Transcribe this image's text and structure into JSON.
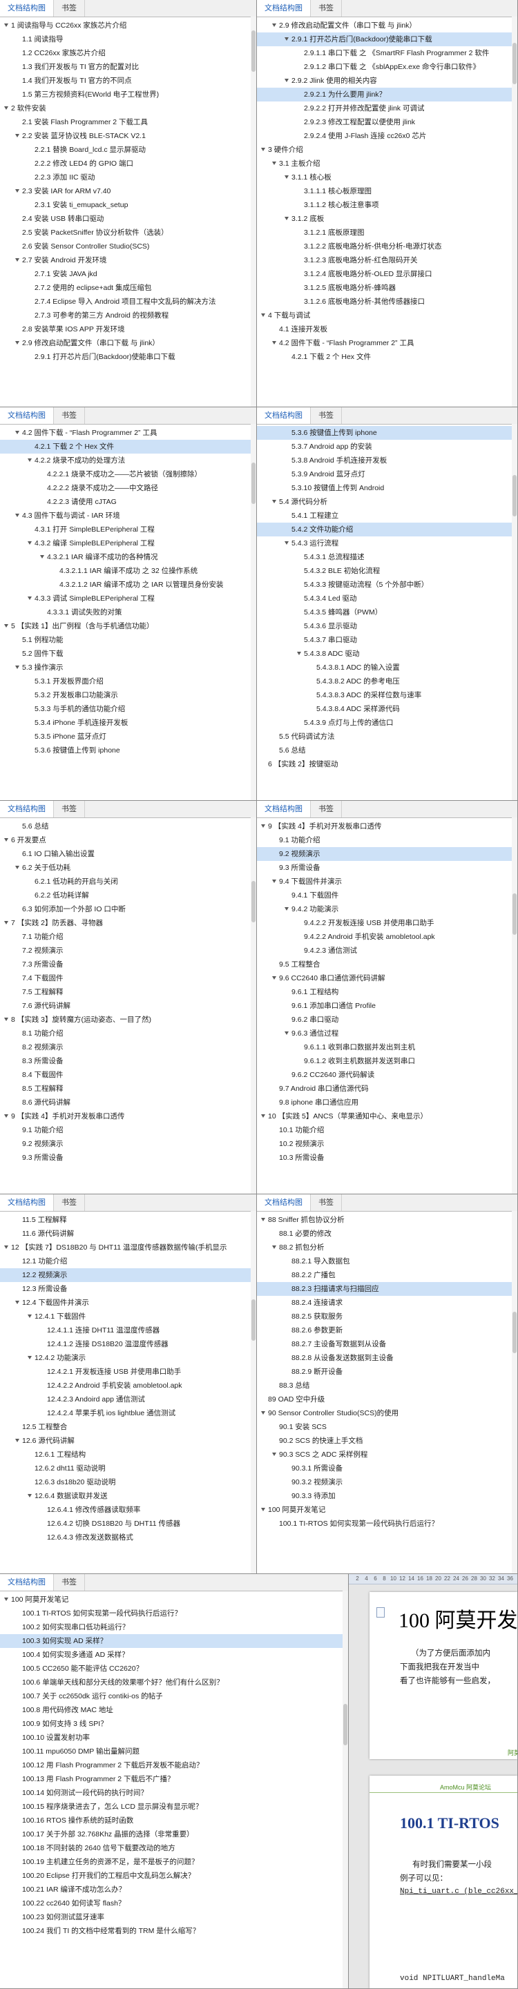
{
  "tabs": {
    "toc": "文档结构图",
    "bookmarks": "书签"
  },
  "panes": [
    {
      "id": "p1",
      "active_tab": "toc",
      "rows": [
        {
          "t": "1 阅读指导与 CC26xx 家族芯片介绍",
          "l": 0,
          "e": true
        },
        {
          "t": "1.1 阅读指导",
          "l": 1
        },
        {
          "t": "1.2 CC26xx 家族芯片介绍",
          "l": 1
        },
        {
          "t": "1.3 我们开发板与 TI 官方的配置对比",
          "l": 1
        },
        {
          "t": "1.4 我们开发板与 TI 官方的不同点",
          "l": 1
        },
        {
          "t": "1.5 第三方视频资料(EWorld 电子工程世界)",
          "l": 1
        },
        {
          "t": "2 软件安装",
          "l": 0,
          "e": true
        },
        {
          "t": "2.1 安装 Flash Programmer 2 下载工具",
          "l": 1
        },
        {
          "t": "2.2 安装 蓝牙协议栈 BLE-STACK V2.1",
          "l": 1,
          "e": true
        },
        {
          "t": "2.2.1 替换 Board_lcd.c 显示屏驱动",
          "l": 2
        },
        {
          "t": "2.2.2 修改 LED4 的 GPIO 端口",
          "l": 2
        },
        {
          "t": "2.2.3 添加 IIC 驱动",
          "l": 2
        },
        {
          "t": "2.3 安装 IAR for ARM v7.40",
          "l": 1,
          "e": true
        },
        {
          "t": "2.3.1 安装 ti_emupack_setup",
          "l": 2
        },
        {
          "t": "2.4 安装 USB 转串口驱动",
          "l": 1
        },
        {
          "t": "2.5 安装 PacketSniffer 协议分析软件（选装）",
          "l": 1
        },
        {
          "t": "2.6 安装 Sensor Controller Studio(SCS)",
          "l": 1
        },
        {
          "t": "2.7 安装 Android 开发环境",
          "l": 1,
          "e": true
        },
        {
          "t": "2.7.1 安装 JAVA jkd",
          "l": 2
        },
        {
          "t": "2.7.2 使用的 eclipse+adt 集成压缩包",
          "l": 2
        },
        {
          "t": "2.7.4 Eclipse 导入 Android 项目工程中文乱码的解决方法",
          "l": 2
        },
        {
          "t": "2.7.3 可参考的第三方 Android 的视频教程",
          "l": 2
        },
        {
          "t": "2.8 安装苹果 IOS APP 开发环境",
          "l": 1
        },
        {
          "t": "2.9 修改启动配置文件（串口下载 与 jlink）",
          "l": 1,
          "e": true
        },
        {
          "t": "2.9.1 打开芯片后门(Backdoor)使能串口下载",
          "l": 2
        }
      ]
    },
    {
      "id": "p2",
      "active_tab": "toc",
      "rows": [
        {
          "t": "2.9 修改启动配置文件（串口下载 与 jlink）",
          "l": 1,
          "e": true
        },
        {
          "t": "2.9.1 打开芯片后门(Backdoor)使能串口下载",
          "l": 2,
          "e": true,
          "sel": true
        },
        {
          "t": "2.9.1.1 串口下载 之 《SmartRF Flash Programmer 2 软件",
          "l": 3
        },
        {
          "t": "2.9.1.2 串口下载 之 《sblAppEx.exe 命令行串口软件》",
          "l": 3
        },
        {
          "t": "2.9.2 Jlink 使用的相关内容",
          "l": 2,
          "e": true
        },
        {
          "t": "2.9.2.1 为什么要用 jlink？",
          "l": 3,
          "sel": true
        },
        {
          "t": "2.9.2.2 打开并修改配置使 jlink 可调试",
          "l": 3
        },
        {
          "t": "2.9.2.3 修改工程配置以便使用 jlink",
          "l": 3
        },
        {
          "t": "2.9.2.4 使用 J-Flash 连接 cc26x0 芯片",
          "l": 3
        },
        {
          "t": "3 硬件介绍",
          "l": 0,
          "e": true
        },
        {
          "t": "3.1 主板介绍",
          "l": 1,
          "e": true
        },
        {
          "t": "3.1.1 核心板",
          "l": 2,
          "e": true
        },
        {
          "t": "3.1.1.1 核心板原理图",
          "l": 3
        },
        {
          "t": "3.1.1.2 核心板注意事项",
          "l": 3
        },
        {
          "t": "3.1.2 底板",
          "l": 2,
          "e": true
        },
        {
          "t": "3.1.2.1 底板原理图",
          "l": 3
        },
        {
          "t": "3.1.2.2 底板电路分析-供电分析-电源灯状态",
          "l": 3
        },
        {
          "t": "3.1.2.3 底板电路分析-红色限码开关",
          "l": 3
        },
        {
          "t": "3.1.2.4 底板电路分析-OLED 显示屏接口",
          "l": 3
        },
        {
          "t": "3.1.2.5 底板电路分析-蜂鸣器",
          "l": 3
        },
        {
          "t": "3.1.2.6 底板电路分析-其他传感器接口",
          "l": 3
        },
        {
          "t": "4 下载与调试",
          "l": 0,
          "e": true
        },
        {
          "t": "4.1 连接开发板",
          "l": 1
        },
        {
          "t": "4.2 固件下载 - “Flash Programmer 2” 工具",
          "l": 1,
          "e": true
        },
        {
          "t": "4.2.1 下载 2 个 Hex 文件",
          "l": 2
        }
      ]
    },
    {
      "id": "p3",
      "active_tab": "toc",
      "rows": [
        {
          "t": "4.2 固件下载 - “Flash Programmer 2” 工具",
          "l": 1,
          "e": true
        },
        {
          "t": "4.2.1 下载 2 个 Hex 文件",
          "l": 2,
          "sel": true
        },
        {
          "t": "4.2.2 烧录不成功的处理方法",
          "l": 2,
          "e": true
        },
        {
          "t": "4.2.2.1 烧录不成功之——芯片被锁（强制擦除）",
          "l": 3
        },
        {
          "t": "4.2.2.2 烧录不成功之——中文路径",
          "l": 3
        },
        {
          "t": "4.2.2.3 请使用 cJTAG",
          "l": 3
        },
        {
          "t": "4.3 固件下载与调试 - IAR 环境",
          "l": 1,
          "e": true
        },
        {
          "t": "4.3.1 打开 SimpleBLEPeripheral 工程",
          "l": 2
        },
        {
          "t": "4.3.2 编译 SimpleBLEPeripheral 工程",
          "l": 2,
          "e": true
        },
        {
          "t": "4.3.2.1 IAR 编译不成功的各种情况",
          "l": 3,
          "e": true
        },
        {
          "t": "4.3.2.1.1 IAR 编译不成功 之 32 位操作系统",
          "l": 4
        },
        {
          "t": "4.3.2.1.2 IAR 编译不成功 之 IAR 以管理员身份安装",
          "l": 4
        },
        {
          "t": "4.3.3 调试 SimpleBLEPeripheral 工程",
          "l": 2,
          "e": true
        },
        {
          "t": "4.3.3.1 调试失败的对策",
          "l": 3
        },
        {
          "t": "5 【实践 1】出厂例程（含与手机通信功能）",
          "l": 0,
          "e": true
        },
        {
          "t": "5.1 例程功能",
          "l": 1
        },
        {
          "t": "5.2 固件下载",
          "l": 1
        },
        {
          "t": "5.3 操作演示",
          "l": 1,
          "e": true
        },
        {
          "t": "5.3.1 开发板界面介绍",
          "l": 2
        },
        {
          "t": "5.3.2 开发板串口功能演示",
          "l": 2
        },
        {
          "t": "5.3.3 与手机的通信功能介绍",
          "l": 2
        },
        {
          "t": "5.3.4 iPhone 手机连接开发板",
          "l": 2
        },
        {
          "t": "5.3.5 iPhone 蓝牙点灯",
          "l": 2
        },
        {
          "t": "5.3.6 按键值上传到 iphone",
          "l": 2
        }
      ]
    },
    {
      "id": "p4",
      "active_tab": "toc",
      "rows": [
        {
          "t": "5.3.6 按键值上传到 iphone",
          "l": 2,
          "sel": true
        },
        {
          "t": "5.3.7 Android app 的安装",
          "l": 2
        },
        {
          "t": "5.3.8 Android 手机连接开发板",
          "l": 2
        },
        {
          "t": "5.3.9 Android 蓝牙点灯",
          "l": 2
        },
        {
          "t": "5.3.10 按键值上传到 Android",
          "l": 2
        },
        {
          "t": "5.4 源代码分析",
          "l": 1,
          "e": true
        },
        {
          "t": "5.4.1 工程建立",
          "l": 2
        },
        {
          "t": "5.4.2 文件功能介绍",
          "l": 2,
          "sel": true
        },
        {
          "t": "5.4.3 运行流程",
          "l": 2,
          "e": true
        },
        {
          "t": "5.4.3.1 总流程描述",
          "l": 3
        },
        {
          "t": "5.4.3.2 BLE 初始化流程",
          "l": 3
        },
        {
          "t": "5.4.3.3 按键驱动流程（5 个外部中断）",
          "l": 3
        },
        {
          "t": "5.4.3.4 Led 驱动",
          "l": 3
        },
        {
          "t": "5.4.3.5 蜂鸣器（PWM）",
          "l": 3
        },
        {
          "t": "5.4.3.6 显示驱动",
          "l": 3
        },
        {
          "t": "5.4.3.7 串口驱动",
          "l": 3
        },
        {
          "t": "5.4.3.8 ADC 驱动",
          "l": 3,
          "e": true
        },
        {
          "t": "5.4.3.8.1 ADC 的输入设置",
          "l": 4
        },
        {
          "t": "5.4.3.8.2 ADC 的参考电压",
          "l": 4
        },
        {
          "t": "5.4.3.8.3 ADC 的采样位数与速率",
          "l": 4
        },
        {
          "t": "5.4.3.8.4 ADC 采样源代码",
          "l": 4
        },
        {
          "t": "5.4.3.9 点灯与上传的通信口",
          "l": 3
        },
        {
          "t": "5.5 代码调试方法",
          "l": 1
        },
        {
          "t": "5.6 总结",
          "l": 1
        },
        {
          "t": "6 【实践 2】按键驱动",
          "l": 0
        }
      ]
    },
    {
      "id": "p5",
      "active_tab": "toc",
      "rows": [
        {
          "t": "5.6 总结",
          "l": 1
        },
        {
          "t": "6 开发要点",
          "l": 0,
          "e": true
        },
        {
          "t": "6.1 IO 口输入输出设置",
          "l": 1
        },
        {
          "t": "6.2 关于低功耗",
          "l": 1,
          "e": true
        },
        {
          "t": "6.2.1 低功耗的开启与关闭",
          "l": 2
        },
        {
          "t": "6.2.2 低功耗详解",
          "l": 2
        },
        {
          "t": "6.3 如何添加一个外部 IO 口中断",
          "l": 1
        },
        {
          "t": "7 【实践 2】防丢器、寻物器",
          "l": 0,
          "e": true
        },
        {
          "t": "7.1 功能介绍",
          "l": 1
        },
        {
          "t": "7.2 视频演示",
          "l": 1
        },
        {
          "t": "7.3 所需设备",
          "l": 1
        },
        {
          "t": "7.4 下载固件",
          "l": 1
        },
        {
          "t": "7.5 工程解释",
          "l": 1
        },
        {
          "t": "7.6 源代码讲解",
          "l": 1
        },
        {
          "t": "8 【实践 3】旋转魔方(运动姿态、一目了然)",
          "l": 0,
          "e": true
        },
        {
          "t": "8.1 功能介绍",
          "l": 1
        },
        {
          "t": "8.2 视频演示",
          "l": 1
        },
        {
          "t": "8.3 所需设备",
          "l": 1
        },
        {
          "t": "8.4 下载固件",
          "l": 1
        },
        {
          "t": "8.5 工程解释",
          "l": 1
        },
        {
          "t": "8.6 源代码讲解",
          "l": 1
        },
        {
          "t": "9 【实践 4】手机对开发板串口透传",
          "l": 0,
          "e": true
        },
        {
          "t": "9.1 功能介绍",
          "l": 1
        },
        {
          "t": "9.2 视频演示",
          "l": 1
        },
        {
          "t": "9.3 所需设备",
          "l": 1
        }
      ]
    },
    {
      "id": "p6",
      "active_tab": "toc",
      "rows": [
        {
          "t": "9 【实践 4】手机对开发板串口透传",
          "l": 0,
          "e": true
        },
        {
          "t": "9.1 功能介绍",
          "l": 1
        },
        {
          "t": "9.2 视频演示",
          "l": 1,
          "sel": true
        },
        {
          "t": "9.3 所需设备",
          "l": 1
        },
        {
          "t": "9.4 下载固件并演示",
          "l": 1,
          "e": true
        },
        {
          "t": "9.4.1 下载固件",
          "l": 2
        },
        {
          "t": "9.4.2 功能演示",
          "l": 2,
          "e": true
        },
        {
          "t": "9.4.2.2 开发板连接 USB 并使用串口助手",
          "l": 3
        },
        {
          "t": "9.4.2.2 Android 手机安装 amobletool.apk",
          "l": 3
        },
        {
          "t": "9.4.2.3 通信测试",
          "l": 3
        },
        {
          "t": "9.5 工程整合",
          "l": 1
        },
        {
          "t": "9.6 CC2640 串口通信源代码讲解",
          "l": 1,
          "e": true
        },
        {
          "t": "9.6.1 工程结构",
          "l": 2
        },
        {
          "t": "9.6.1 添加串口通信 Profile",
          "l": 2
        },
        {
          "t": "9.6.2 串口驱动",
          "l": 2
        },
        {
          "t": "9.6.3 通信过程",
          "l": 2,
          "e": true
        },
        {
          "t": "9.6.1.1 收到串口数据并发出到主机",
          "l": 3
        },
        {
          "t": "9.6.1.2 收到主机数据并发送到串口",
          "l": 3
        },
        {
          "t": "9.6.2 CC2640 源代码解读",
          "l": 2
        },
        {
          "t": "9.7 Android 串口通信源代码",
          "l": 1
        },
        {
          "t": "9.8 iphone 串口通信应用",
          "l": 1
        },
        {
          "t": "10 【实践 5】ANCS（苹果通知中心、来电显示）",
          "l": 0,
          "e": true
        },
        {
          "t": "10.1 功能介绍",
          "l": 1
        },
        {
          "t": "10.2 视频演示",
          "l": 1
        },
        {
          "t": "10.3 所需设备",
          "l": 1
        }
      ]
    },
    {
      "id": "p7",
      "active_tab": "toc",
      "rows": [
        {
          "t": "11.5 工程解释",
          "l": 1
        },
        {
          "t": "11.6 源代码讲解",
          "l": 1
        },
        {
          "t": "12 【实践 7】DS18B20 与 DHT11 温湿度传感器数据传输(手机显示",
          "l": 0,
          "e": true
        },
        {
          "t": "12.1 功能介绍",
          "l": 1
        },
        {
          "t": "12.2 视频演示",
          "l": 1,
          "sel": true
        },
        {
          "t": "12.3 所需设备",
          "l": 1
        },
        {
          "t": "12.4 下载固件并演示",
          "l": 1,
          "e": true
        },
        {
          "t": "12.4.1 下载固件",
          "l": 2,
          "e": true
        },
        {
          "t": "12.4.1.1 连接 DHT11 温湿度传感器",
          "l": 3
        },
        {
          "t": "12.4.1.2 连接 DS18B20 温湿度传感器",
          "l": 3
        },
        {
          "t": "12.4.2 功能演示",
          "l": 2,
          "e": true
        },
        {
          "t": "12.4.2.1 开发板连接 USB 并使用串口助手",
          "l": 3
        },
        {
          "t": "12.4.2.2 Android 手机安装 amobletool.apk",
          "l": 3
        },
        {
          "t": "12.4.2.3 Andoird app 通信测试",
          "l": 3
        },
        {
          "t": "12.4.2.4 苹果手机 ios lightblue 通信测试",
          "l": 3
        },
        {
          "t": "12.5 工程整合",
          "l": 1
        },
        {
          "t": "12.6 源代码讲解",
          "l": 1,
          "e": true
        },
        {
          "t": "12.6.1 工程结构",
          "l": 2
        },
        {
          "t": "12.6.2 dht11 驱动说明",
          "l": 2
        },
        {
          "t": "12.6.3 ds18b20 驱动说明",
          "l": 2
        },
        {
          "t": "12.6.4 数据读取并发送",
          "l": 2,
          "e": true
        },
        {
          "t": "12.6.4.1 修改传感器读取频率",
          "l": 3
        },
        {
          "t": "12.6.4.2 切换 DS18B20 与 DHT11 传感器",
          "l": 3
        },
        {
          "t": "12.6.4.3 修改发送数据格式",
          "l": 3
        }
      ]
    },
    {
      "id": "p8",
      "active_tab": "toc",
      "rows": [
        {
          "t": "88 Sniffer 抓包协议分析",
          "l": 0,
          "e": true
        },
        {
          "t": "88.1 必要的修改",
          "l": 1
        },
        {
          "t": "88.2 抓包分析",
          "l": 1,
          "e": true
        },
        {
          "t": "88.2.1 导入数据包",
          "l": 2
        },
        {
          "t": "88.2.2 广播包",
          "l": 2
        },
        {
          "t": "88.2.3 扫描请求与扫描回应",
          "l": 2,
          "sel": true
        },
        {
          "t": "88.2.4 连接请求",
          "l": 2
        },
        {
          "t": "88.2.5 获取服务",
          "l": 2
        },
        {
          "t": "88.2.6 参数更新",
          "l": 2
        },
        {
          "t": "88.2.7 主设备写数据到从设备",
          "l": 2
        },
        {
          "t": "88.2.8 从设备发送数据到主设备",
          "l": 2
        },
        {
          "t": "88.2.9 断开设备",
          "l": 2
        },
        {
          "t": "88.3 总结",
          "l": 1
        },
        {
          "t": "89 OAD 空中升级",
          "l": 0
        },
        {
          "t": "90 Sensor Controller Studio(SCS)的使用",
          "l": 0,
          "e": true
        },
        {
          "t": "90.1 安装 SCS",
          "l": 1
        },
        {
          "t": "90.2 SCS 的快速上手文档",
          "l": 1
        },
        {
          "t": "90.3 SCS 之 ADC 采样例程",
          "l": 1,
          "e": true
        },
        {
          "t": "90.3.1 所需设备",
          "l": 2
        },
        {
          "t": "90.3.2 视频演示",
          "l": 2
        },
        {
          "t": "90.3.3 待添加",
          "l": 2
        },
        {
          "t": "100 阿莫开发笔记",
          "l": 0,
          "e": true
        },
        {
          "t": "100.1 TI-RTOS 如何实现第一段代码执行后运行？",
          "l": 1
        }
      ]
    },
    {
      "id": "p9",
      "active_tab": "toc",
      "rows": [
        {
          "t": "100 阿莫开发笔记",
          "l": 0,
          "e": true
        },
        {
          "t": "100.1 TI-RTOS 如何实现第一段代码执行后运行？",
          "l": 1
        },
        {
          "t": "100.2 如何实现串口低功耗运行？",
          "l": 1
        },
        {
          "t": "100.3 如何实现 AD 采样？",
          "l": 1,
          "sel": true
        },
        {
          "t": "100.4 如何实现多通道 AD 采样？",
          "l": 1
        },
        {
          "t": "100.5 CC2650 能不能评估 CC2620？",
          "l": 1
        },
        {
          "t": "100.6 单端单天线和部分天线的效果哪个好？他们有什么区别？",
          "l": 1
        },
        {
          "t": "100.7 关于 cc2650dk 运行 contiki-os 的帖子",
          "l": 1
        },
        {
          "t": "100.8 用代码修改 MAC 地址",
          "l": 1
        },
        {
          "t": "100.9 如何支持 3 线 SPI？",
          "l": 1
        },
        {
          "t": "100.10 设置发射功率",
          "l": 1
        },
        {
          "t": "100.11 mpu6050 DMP 输出量解问题",
          "l": 1
        },
        {
          "t": "100.12 用 Flash Programmer 2 下载后开发板不能启动？",
          "l": 1
        },
        {
          "t": "100.13 用 Flash Programmer 2 下载后不广播？",
          "l": 1
        },
        {
          "t": "100.14 如何测试一段代码的执行时间？",
          "l": 1
        },
        {
          "t": "100.15 程序烧录进去了，怎么 LCD 显示屏没有显示呢？",
          "l": 1
        },
        {
          "t": "100.16 RTOS 操作系统的延时函数",
          "l": 1
        },
        {
          "t": "100.17 关于外部 32.768Khz 晶振的选择（非常重要）",
          "l": 1
        },
        {
          "t": "100.18 不同封装的 2640 信号下载要改动的地方",
          "l": 1
        },
        {
          "t": "100.19 主机建立任务的资源不足，是不是板子的问题？",
          "l": 1
        },
        {
          "t": "100.20 Eclipse 打开我们的工程后中文乱码怎么解决？",
          "l": 1
        },
        {
          "t": "100.21 IAR 编译不成功怎么办？",
          "l": 1
        },
        {
          "t": "100.22 cc2640 如何读写 flash？",
          "l": 1
        },
        {
          "t": "100.23 如何测试蓝牙速率",
          "l": 1
        },
        {
          "t": "100.24 我们 TI 的文档中经常看到的 TRM 是什么缩写？",
          "l": 1
        }
      ]
    }
  ],
  "doc": {
    "ruler_ticks": [
      "2",
      "4",
      "6",
      "8",
      "10",
      "12",
      "14",
      "16",
      "18",
      "20",
      "22",
      "24",
      "26",
      "28",
      "30",
      "32",
      "34",
      "36"
    ],
    "page1": {
      "heading": "100 阿莫开发",
      "lines": [
        "（为了方便后面添加内",
        "下面我把我在开发当中",
        "看了也许能够有一些启发，"
      ],
      "footer": "阿莫"
    },
    "page2": {
      "header_mark": "AmoMcu 阿莫论坛",
      "heading": "100.1 TI-RTOS",
      "lines": [
        "有时我们需要某一小段",
        "例子可以见："
      ],
      "code_line": "Npi_ti_uart.c (ble_cc26xx_2_",
      "code_bottom": "void NPITLUART_handleMa"
    }
  },
  "colors": {
    "tab_active": "#1e5fb8",
    "selection": "#cde1f7",
    "heading_blue": "#1f3f8f",
    "footer_green": "#4c8e1f"
  }
}
